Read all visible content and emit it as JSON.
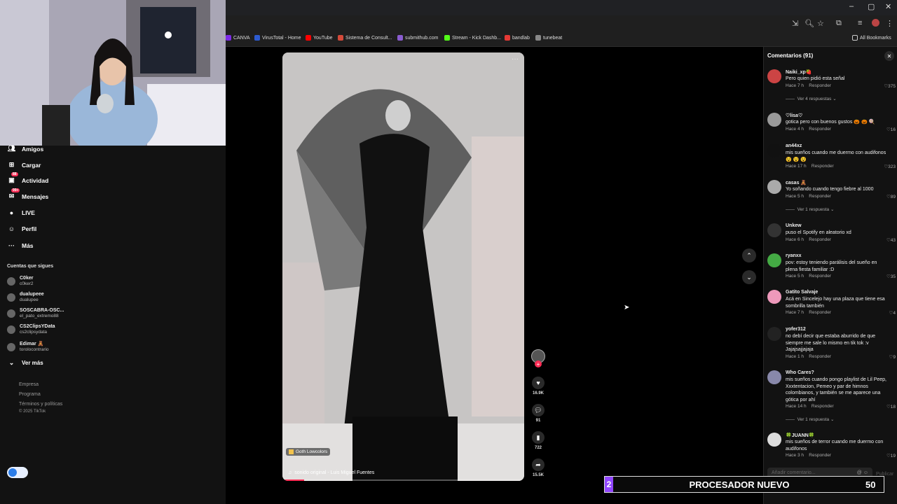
{
  "browser": {
    "window_controls": [
      "–",
      "▢",
      "✕"
    ],
    "bookmarks": [
      {
        "label": "CANVA",
        "color": "#7d2ae8"
      },
      {
        "label": "VirusTotal - Home",
        "color": "#2d5bd0"
      },
      {
        "label": "YouTube",
        "color": "#ff0000"
      },
      {
        "label": "Sistema de Consult...",
        "color": "#d44a3a"
      },
      {
        "label": "submithub.com",
        "color": "#8a5cd0"
      },
      {
        "label": "Stream - Kick Dashb...",
        "color": "#53fc18"
      },
      {
        "label": "bandlab",
        "color": "#e53935"
      },
      {
        "label": "tunebeat",
        "color": "#888888"
      }
    ],
    "all_bookmarks": "All Bookmarks"
  },
  "sidebar": {
    "nav": [
      {
        "label": "Amigos",
        "icon": "friends-icon",
        "badge": ""
      },
      {
        "label": "Cargar",
        "icon": "upload-icon",
        "badge": ""
      },
      {
        "label": "Actividad",
        "icon": "activity-icon",
        "badge": "88"
      },
      {
        "label": "Mensajes",
        "icon": "messages-icon",
        "badge": "99+"
      },
      {
        "label": "LIVE",
        "icon": "live-icon",
        "badge": ""
      },
      {
        "label": "Perfil",
        "icon": "profile-icon",
        "badge": ""
      },
      {
        "label": "Más",
        "icon": "more-icon",
        "badge": ""
      }
    ],
    "following_title": "Cuentas que sigues",
    "following": [
      {
        "name": "C0ker",
        "handle": "c0ker2"
      },
      {
        "name": "dualupeee",
        "handle": "dualupee"
      },
      {
        "name": "SOSCABRA-OSC...",
        "handle": "el_pato_extremo88"
      },
      {
        "name": "CS2ClipsYData",
        "handle": "cs2clipsydata"
      },
      {
        "name": "Edimar 🧸",
        "handle": "torolocontrario"
      }
    ],
    "see_more": "Ver más",
    "footer": [
      "Empresa",
      "Programa",
      "Términos y políticas",
      "© 2025 TikTok"
    ]
  },
  "video": {
    "tag": "Goth Lowcolors",
    "sound": "sonido original - Luis Miguel Fuentes",
    "more": "···",
    "likes": "16.9K",
    "comments": "91",
    "saves": "722",
    "shares": "15.5K",
    "progress": 0.09
  },
  "comments_panel": {
    "title": "Comentarios (91)",
    "reply_label": "Responder",
    "input_placeholder": "Añadir comentario...",
    "post_label": "Publicar",
    "items": [
      {
        "user": "Naiki_xp🍓",
        "text": "Pero quien pidió esta señal",
        "time": "Hace 7 h",
        "likes": "375",
        "replies": "Ver 4 respuestas"
      },
      {
        "user": "♡lisa♡",
        "text": "gotica pero con buenos gustos 🎃 🎃 🍭",
        "time": "Hace 4 h",
        "likes": "16",
        "replies": ""
      },
      {
        "user": "an44xz",
        "text": "mis sueños cuando me duermo con audifonos 😵 😵 😵",
        "time": "Hace 17 h",
        "likes": "323",
        "replies": ""
      },
      {
        "user": "casas 🧸",
        "text": "Yo soñando cuando tengo fiebre al 1000",
        "time": "Hace 5 h",
        "likes": "89",
        "replies": "Ver 1 respuesta"
      },
      {
        "user": "Unkew",
        "text": "puso el Spotify en aleatorio xd",
        "time": "Hace 6 h",
        "likes": "43",
        "replies": ""
      },
      {
        "user": "ryanxx",
        "text": "pov: estoy teniendo parálisis del sueño en plena fiesta familiar :D",
        "time": "Hace 5 h",
        "likes": "35",
        "replies": ""
      },
      {
        "user": "Gatito Salvaje",
        "text": "Acá en Sincelejo hay una plaza que tiene esa sombrilla también",
        "time": "Hace 7 h",
        "likes": "4",
        "replies": ""
      },
      {
        "user": "yofer312",
        "text": "no debí decir que estaba aburrido de que siempre me sale lo mismo en tik tok :v Jajajsajjajaja",
        "time": "Hace 1 h",
        "likes": "9",
        "replies": ""
      },
      {
        "user": "Who Cares?",
        "text": "mis sueños cuando pongo playlist de Lil Peep, Xxxtentacion, Pemeo y par de himnos colombianos, y también se me aparece una gótica por ahí",
        "time": "Hace 14 h",
        "likes": "18",
        "replies": "Ver 1 respuesta"
      },
      {
        "user": "🍀JUANN🍀",
        "text": "mis sueños de terror cuando me duermo con audifonos",
        "time": "Hace 3 h",
        "likes": "19",
        "replies": ""
      }
    ]
  },
  "banner": {
    "left": "2",
    "title": "PROCESADOR NUEVO",
    "right": "50"
  }
}
